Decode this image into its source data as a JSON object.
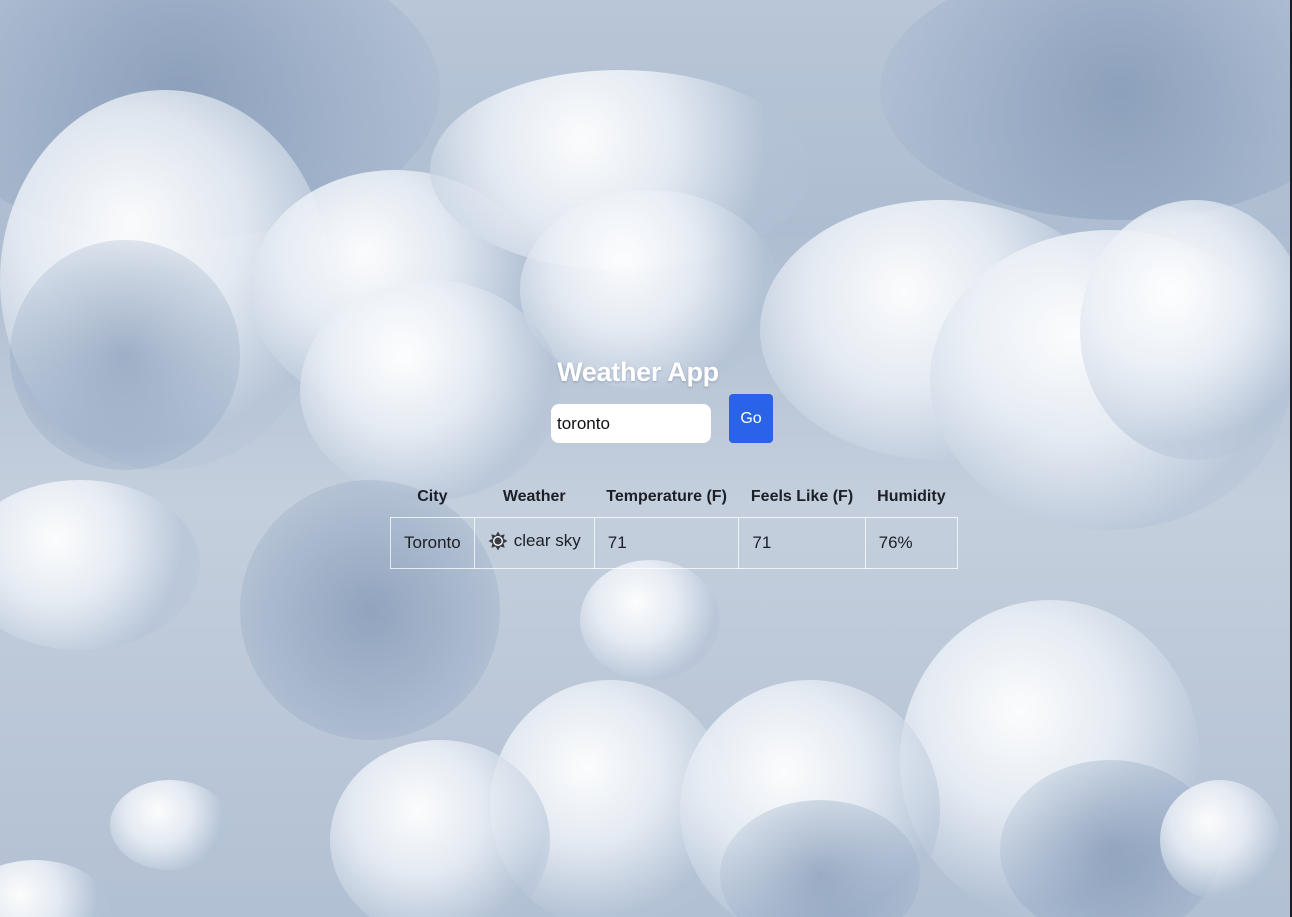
{
  "app": {
    "title": "Weather App"
  },
  "search": {
    "value": "toronto",
    "button_label": "Go"
  },
  "table": {
    "headers": {
      "city": "City",
      "weather": "Weather",
      "temperature": "Temperature (F)",
      "feels_like": "Feels Like (F)",
      "humidity": "Humidity"
    },
    "rows": [
      {
        "city": "Toronto",
        "weather_icon": "sun-icon",
        "weather": "clear sky",
        "temperature": "71",
        "feels_like": "71",
        "humidity": "76%"
      }
    ]
  },
  "colors": {
    "accent": "#2a62e8",
    "title": "#ffffff",
    "text": "#1c1f26"
  }
}
